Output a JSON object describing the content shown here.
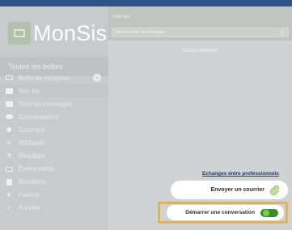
{
  "app": {
    "logo_text": "MonSisra"
  },
  "sidebar": {
    "all_boxes_label": "Toutes les boîtes",
    "items": [
      {
        "label": "Boîte de réception",
        "icon": "inbox-icon"
      },
      {
        "label": "Non lus",
        "icon": "envelope-icon"
      },
      {
        "label": "Tous les messages",
        "icon": "envelope-icon"
      },
      {
        "label": "Conversations",
        "icon": "chat-icon"
      },
      {
        "label": "Courriers",
        "icon": "mail-icon"
      },
      {
        "label": "MSSanté",
        "icon": "star-icon"
      },
      {
        "label": "Résultats",
        "icon": "results-icon"
      },
      {
        "label": "Évènements",
        "icon": "calendar-icon"
      },
      {
        "label": "Brouillons",
        "icon": "draft-icon"
      },
      {
        "label": "Favoris",
        "icon": "star-icon"
      },
      {
        "label": "À traiter",
        "icon": "check-icon"
      }
    ]
  },
  "main": {
    "folder_title": "Non lus",
    "search_placeholder": "Rechercher un message",
    "empty_text": "Aucun élément"
  },
  "actions": {
    "exchanges_link": "Echanges entre professionnels",
    "send_mail_label": "Envoyer un courrier",
    "start_conversation_label": "Démarrer une conversation",
    "highlight_color": "#f3b02d",
    "toggle_color": "#3b8a2c"
  }
}
